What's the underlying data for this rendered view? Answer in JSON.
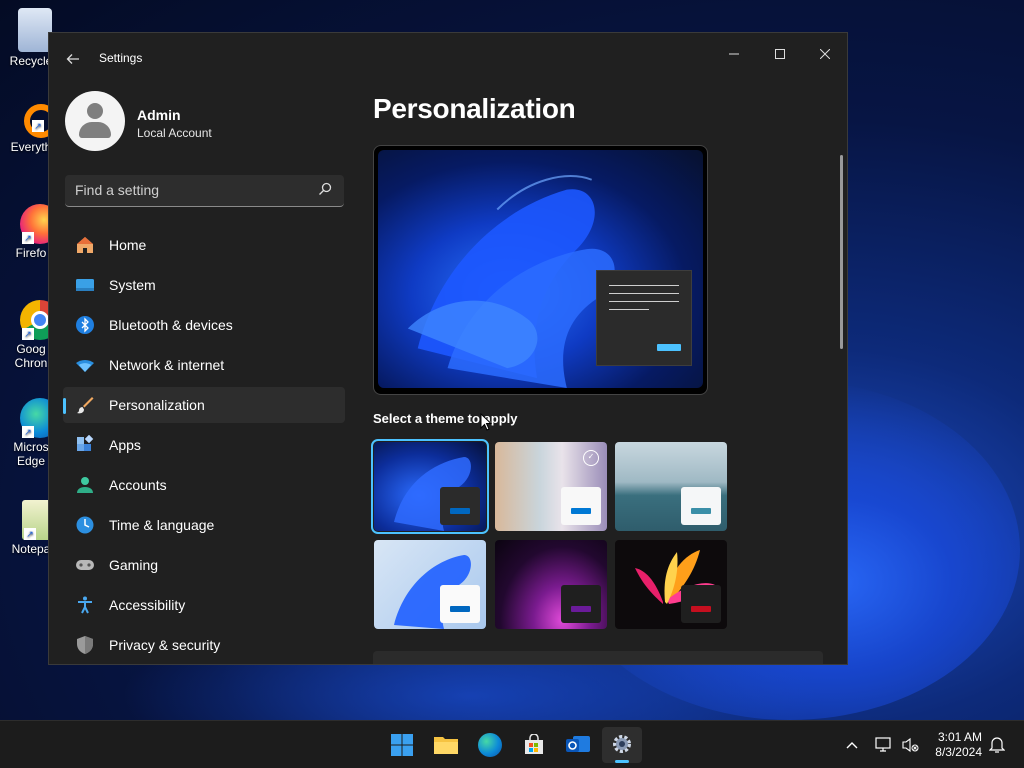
{
  "desktop": {
    "icons": [
      {
        "label": "Recycle"
      },
      {
        "label": "Everyth"
      },
      {
        "label": "Firefo"
      },
      {
        "label": "Goog Chron"
      },
      {
        "label": "Micros Edge"
      },
      {
        "label": "Notepa"
      }
    ]
  },
  "window": {
    "title": "Settings",
    "back_icon": "back-arrow-icon",
    "controls": [
      "minimize",
      "maximize",
      "close"
    ]
  },
  "profile": {
    "name": "Admin",
    "account_type": "Local Account"
  },
  "search": {
    "placeholder": "Find a setting"
  },
  "nav": {
    "items": [
      {
        "label": "Home",
        "icon": "home-icon"
      },
      {
        "label": "System",
        "icon": "system-icon"
      },
      {
        "label": "Bluetooth & devices",
        "icon": "bluetooth-icon"
      },
      {
        "label": "Network & internet",
        "icon": "wifi-icon"
      },
      {
        "label": "Personalization",
        "icon": "brush-icon",
        "active": true
      },
      {
        "label": "Apps",
        "icon": "apps-icon"
      },
      {
        "label": "Accounts",
        "icon": "person-icon"
      },
      {
        "label": "Time & language",
        "icon": "clock-globe-icon"
      },
      {
        "label": "Gaming",
        "icon": "gamepad-icon"
      },
      {
        "label": "Accessibility",
        "icon": "accessibility-icon"
      },
      {
        "label": "Privacy & security",
        "icon": "shield-icon"
      }
    ]
  },
  "main": {
    "title": "Personalization",
    "theme_section_label": "Select a theme to apply",
    "themes": [
      {
        "name": "windows-dark-bloom",
        "selected": true,
        "accent": "#0067c0"
      },
      {
        "name": "spotlight-collection",
        "selected": false,
        "accent": "#0078d4"
      },
      {
        "name": "glow-lake",
        "selected": false,
        "accent": "#3a8fa8"
      },
      {
        "name": "windows-light-bloom",
        "selected": false,
        "accent": "#0067c0"
      },
      {
        "name": "captured-motion",
        "selected": false,
        "accent": "#6a1b9a"
      },
      {
        "name": "flow",
        "selected": false,
        "accent": "#c50f1f"
      }
    ]
  },
  "taskbar": {
    "apps": [
      "start",
      "file-explorer",
      "edge",
      "store",
      "outlook-new",
      "settings"
    ],
    "time": "3:01 AM",
    "date": "8/3/2024"
  },
  "colors": {
    "accent": "#4cc2ff",
    "window_bg": "#202020",
    "taskbar_bg": "#1c1c1c"
  }
}
